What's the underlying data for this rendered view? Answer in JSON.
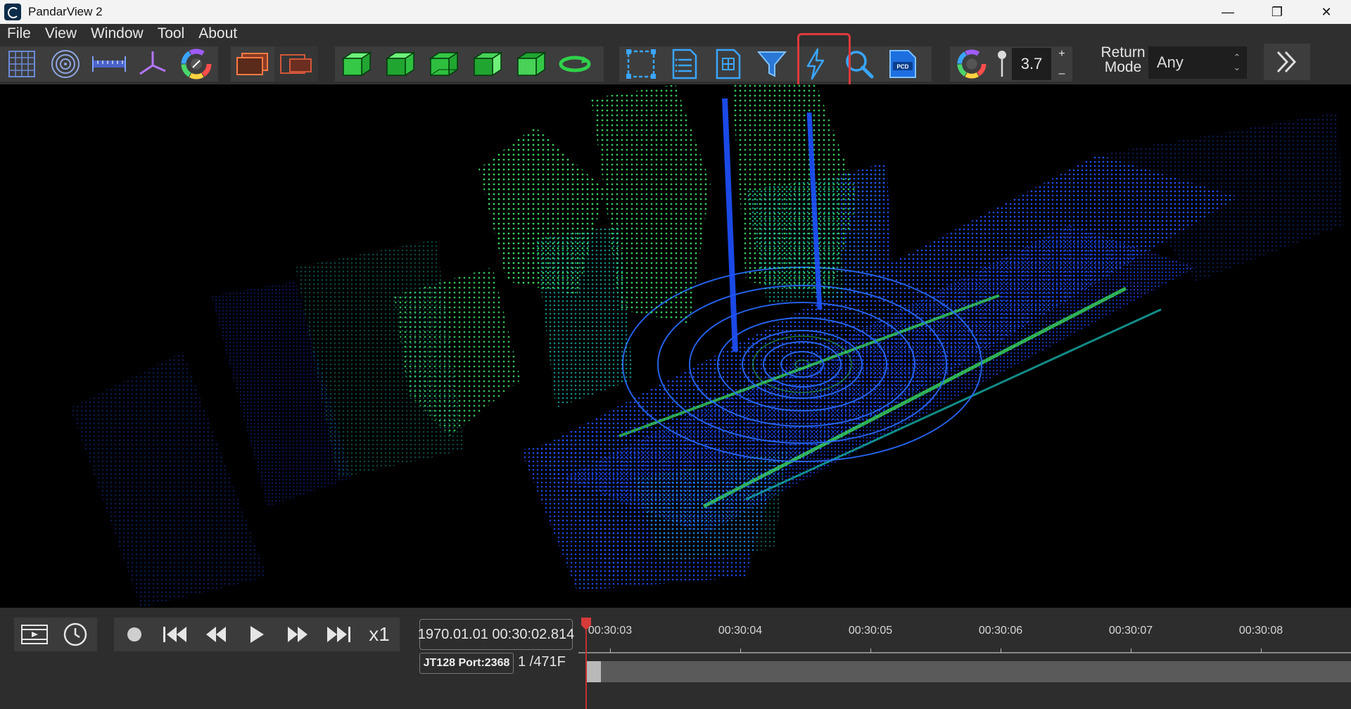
{
  "window": {
    "title": "PandarView 2",
    "controls": {
      "minimize": "—",
      "restore": "❐",
      "close": "✕"
    }
  },
  "menu": {
    "items": [
      "File",
      "View",
      "Window",
      "Tool",
      "About"
    ]
  },
  "toolbar": {
    "view_tools": [
      "grid-icon",
      "concentric-rings-icon",
      "ruler-icon",
      "axes-icon",
      "color-wheel-icon"
    ],
    "frame_tools": [
      "frames-overlay-icon",
      "frames-red-icon"
    ],
    "cube_views": [
      "cube-front-icon",
      "cube-side-icon",
      "cube-top-icon",
      "cube-right-icon",
      "cube-left-icon",
      "rotate-reset-icon"
    ],
    "analysis_tools": [
      "select-rect-icon",
      "point-list-icon",
      "table-icon",
      "filter-icon",
      "lightning-icon",
      "search-icon",
      "pcd-icon"
    ],
    "highlighted_tool": "lightning-icon",
    "point_size": {
      "value": "3.7",
      "plus": "+",
      "minus": "–"
    },
    "return_mode": {
      "label_line1": "Return",
      "label_line2": "Mode",
      "value": "Any"
    },
    "more": "chevron-double-right-icon"
  },
  "playback": {
    "speed": "x1",
    "timestamp": "1970.01.01 00:30:02.814",
    "port": "JT128 Port:2368",
    "frame": "1 /471F",
    "ticks": [
      "00:30:03",
      "00:30:04",
      "00:30:05",
      "00:30:06",
      "00:30:07",
      "00:30:08"
    ]
  },
  "colors": {
    "toolbar_bg": "#2f2f2f",
    "button_bg": "#3d3d3d",
    "highlight": "#e0393b",
    "point_blue": "#1a4dff",
    "point_green": "#3ee86a",
    "playhead": "#d63a3a"
  }
}
